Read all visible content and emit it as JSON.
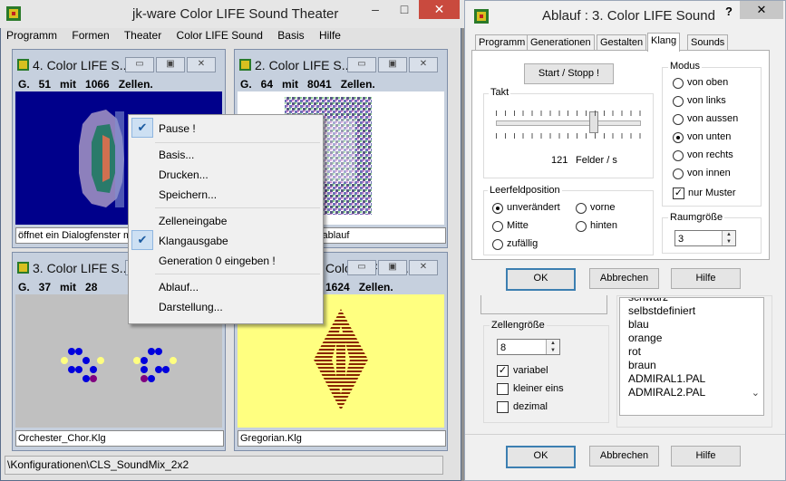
{
  "main": {
    "title": "jk-ware Color LIFE Sound Theater",
    "menu": [
      "Programm",
      "Formen",
      "Theater",
      "Color LIFE Sound",
      "Basis",
      "Hilfe"
    ],
    "status": "\\Konfigurationen\\CLS_SoundMix_2x2"
  },
  "children": [
    {
      "title": "4. Color LIFE S...",
      "stats": "G.   51   mit   1066   Zellen.",
      "status": "öffnet ein Dialogfenster m"
    },
    {
      "title": "2. Color LIFE S...",
      "stats": "G.   64   mit   8041   Zellen.",
      "status": "cht den Programmablauf"
    },
    {
      "title": "3. Color LIFE S...",
      "stats": "G.   37   mit   28",
      "status": "Orchester_Chor.Klg"
    },
    {
      "title": "Color LIFE S...",
      "stats": "1624   Zellen.",
      "status": "Gregorian.Klg"
    }
  ],
  "context_menu": {
    "items": [
      {
        "label": "Pause !",
        "checked": true
      },
      {
        "label": "Basis...",
        "checked": false
      },
      {
        "label": "Drucken...",
        "checked": false
      },
      {
        "label": "Speichern...",
        "checked": false
      },
      {
        "label": "Zelleneingabe",
        "checked": false
      },
      {
        "label": "Klangausgabe",
        "checked": true
      },
      {
        "label": "Generation 0 eingeben !",
        "checked": false
      },
      {
        "label": "Ablauf...",
        "checked": false
      },
      {
        "label": "Darstellung...",
        "checked": false
      }
    ]
  },
  "dialog": {
    "title": "Ablauf : 3. Color LIFE Sound",
    "help_glyph": "?",
    "close_glyph": "✕",
    "tabs": [
      "Programm",
      "Generationen",
      "Gestalten",
      "Klang",
      "Sounds"
    ],
    "selected_tab": "Klang",
    "start_stop": "Start / Stopp !",
    "takt": {
      "label": "Takt",
      "value": "121",
      "unit": "Felder / s",
      "slider_fraction": 0.68
    },
    "leerfeld": {
      "label": "Leerfeldposition",
      "options": [
        "unverändert",
        "vorne",
        "Mitte",
        "hinten",
        "zufällig"
      ],
      "selected": "unverändert"
    },
    "modus": {
      "label": "Modus",
      "options": [
        "von oben",
        "von links",
        "von aussen",
        "von unten",
        "von rechts",
        "von innen"
      ],
      "selected": "von unten",
      "nur_muster_label": "nur Muster",
      "nur_muster": true
    },
    "raumgroesse": {
      "label": "Raumgröße",
      "value": "3"
    },
    "buttons": {
      "ok": "OK",
      "cancel": "Abbrechen",
      "help": "Hilfe"
    },
    "zellengroesse": {
      "label": "Zellengröße",
      "value": "8"
    },
    "checks": [
      {
        "label": "variabel",
        "checked": true
      },
      {
        "label": "kleiner eins",
        "checked": false
      },
      {
        "label": "dezimal",
        "checked": false
      }
    ],
    "palettes": [
      "schwarz",
      "selbstdefiniert",
      "blau",
      "orange",
      "rot",
      "braun",
      "ADMIRAL1.PAL",
      "ADMIRAL2.PAL"
    ],
    "bottom_buttons": {
      "ok": "OK",
      "cancel": "Abbrechen",
      "help": "Hilfe"
    }
  },
  "colors": {
    "blue_canvas": "#00008b",
    "yellow_canvas": "#ffff80",
    "gray_canvas": "#c0c0c0",
    "accent": "#3c7fb1"
  }
}
